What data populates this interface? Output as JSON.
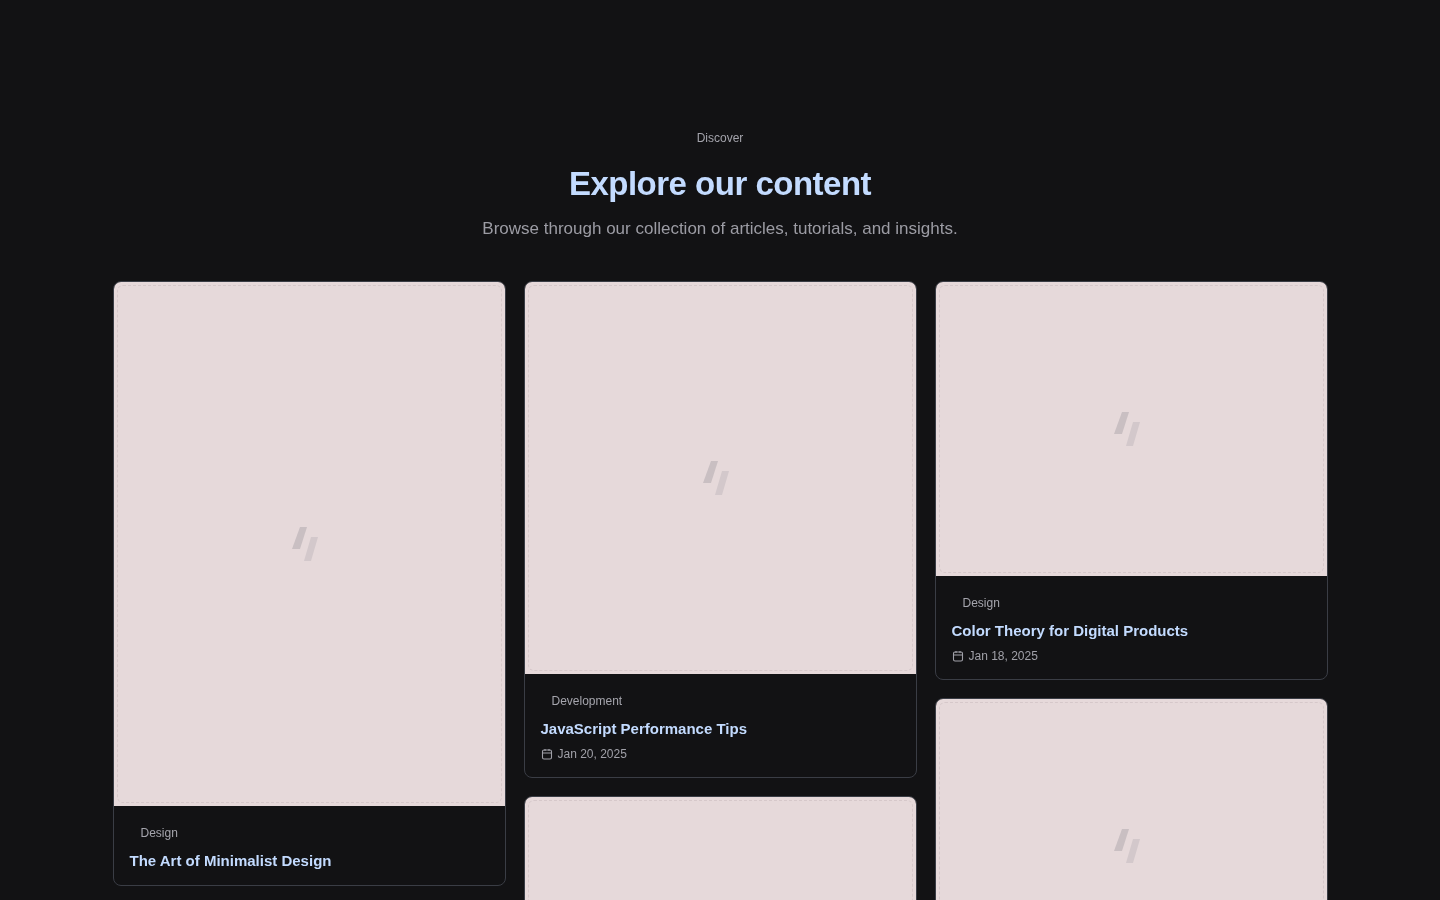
{
  "header": {
    "eyebrow": "Discover",
    "title": "Explore our content",
    "subtitle": "Browse through our collection of articles, tutorials, and insights."
  },
  "columns": [
    {
      "cards": [
        {
          "kind": "article",
          "tag": "Design",
          "title": "The Art of Minimalist Design"
        }
      ]
    },
    {
      "cards": [
        {
          "kind": "article",
          "tag": "Development",
          "title": "JavaScript Performance Tips",
          "date": "Jan 20, 2025"
        },
        {
          "kind": "placeholder"
        }
      ]
    },
    {
      "cards": [
        {
          "kind": "article",
          "tag": "Design",
          "title": "Color Theory for Digital Products",
          "date": "Jan 18, 2025"
        },
        {
          "kind": "placeholder"
        }
      ]
    }
  ]
}
